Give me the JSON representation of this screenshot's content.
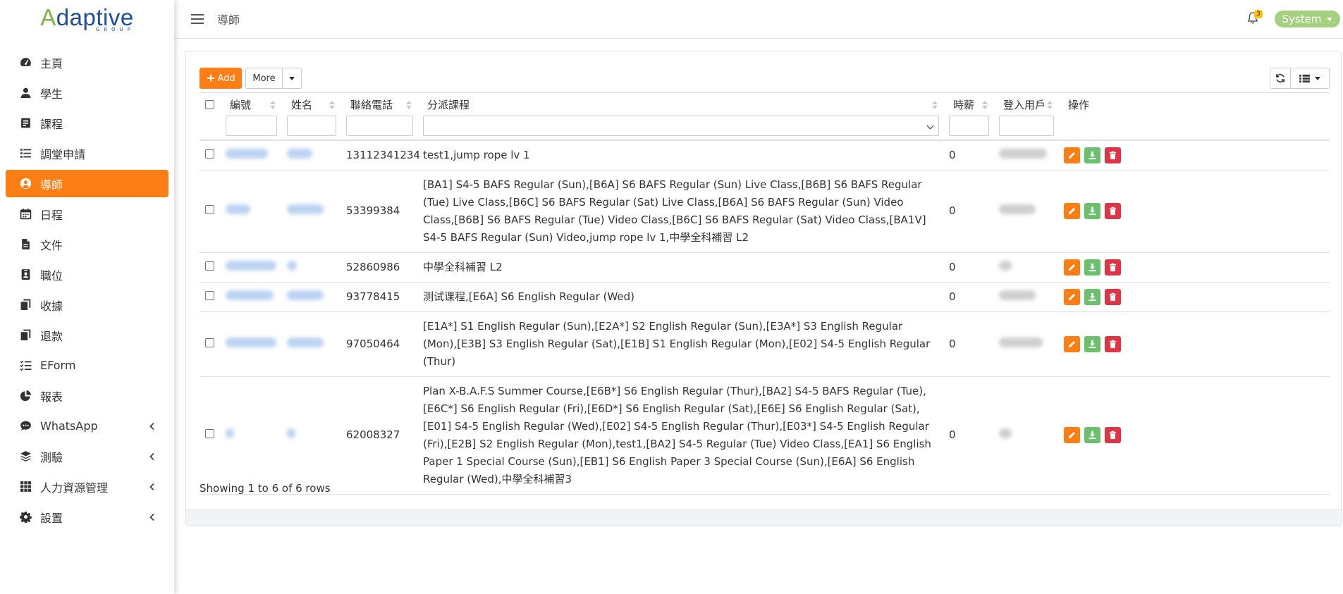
{
  "brand": {
    "logo_text_a": "A",
    "logo_text_rest": "daptive",
    "logo_sub": "GROUP"
  },
  "sidebar": {
    "items": [
      {
        "label": "主頁",
        "icon": "dashboard-icon",
        "active": false,
        "submenu": false
      },
      {
        "label": "學生",
        "icon": "user-icon",
        "active": false,
        "submenu": false
      },
      {
        "label": "課程",
        "icon": "course-icon",
        "active": false,
        "submenu": false
      },
      {
        "label": "調堂申請",
        "icon": "list-icon",
        "active": false,
        "submenu": false
      },
      {
        "label": "導師",
        "icon": "user-circle-icon",
        "active": true,
        "submenu": false
      },
      {
        "label": "日程",
        "icon": "calendar-icon",
        "active": false,
        "submenu": false
      },
      {
        "label": "文件",
        "icon": "file-icon",
        "active": false,
        "submenu": false
      },
      {
        "label": "職位",
        "icon": "id-badge-icon",
        "active": false,
        "submenu": false
      },
      {
        "label": "收據",
        "icon": "copy-icon",
        "active": false,
        "submenu": false
      },
      {
        "label": "退款",
        "icon": "copy-icon",
        "active": false,
        "submenu": false
      },
      {
        "label": "EForm",
        "icon": "checklist-icon",
        "active": false,
        "submenu": false
      },
      {
        "label": "報表",
        "icon": "pie-chart-icon",
        "active": false,
        "submenu": false
      },
      {
        "label": "WhatsApp",
        "icon": "chat-icon",
        "active": false,
        "submenu": true
      },
      {
        "label": "測驗",
        "icon": "layers-icon",
        "active": false,
        "submenu": true
      },
      {
        "label": "人力資源管理",
        "icon": "grid-icon",
        "active": false,
        "submenu": true
      },
      {
        "label": "設置",
        "icon": "gear-icon",
        "active": false,
        "submenu": true
      }
    ]
  },
  "header": {
    "title": "導師",
    "notification_count": "3",
    "user": "System"
  },
  "toolbar": {
    "add_label": "Add",
    "more_label": "More"
  },
  "table": {
    "columns": [
      "編號",
      "姓名",
      "聯絡電話",
      "分派課程",
      "時薪",
      "登入用戶",
      "操作"
    ],
    "rows": [
      {
        "phone": "13112341234",
        "courses": "test1,jump rope lv 1",
        "rate": "0"
      },
      {
        "phone": "53399384",
        "courses": "[BA1] S4-5 BAFS Regular (Sun),[B6A] S6 BAFS Regular (Sun) Live Class,[B6B] S6 BAFS Regular (Tue) Live Class,[B6C] S6 BAFS Regular (Sat) Live Class,[B6A] S6 BAFS Regular (Sun) Video Class,[B6B] S6 BAFS Regular (Tue) Video Class,[B6C] S6 BAFS Regular (Sat) Video Class,[BA1V] S4-5 BAFS Regular (Sun) Video,jump rope lv 1,中學全科補習 L2",
        "rate": "0"
      },
      {
        "phone": "52860986",
        "courses": "中學全科補習 L2",
        "rate": "0"
      },
      {
        "phone": "93778415",
        "courses": "测试课程,[E6A] S6 English Regular (Wed)",
        "rate": "0"
      },
      {
        "phone": "97050464",
        "courses": "[E1A*] S1 English Regular (Sun),[E2A*] S2 English Regular (Sun),[E3A*] S3 English Regular (Mon),[E3B] S3 English Regular (Sat),[E1B] S1 English Regular (Mon),[E02] S4-5 English Regular (Thur)",
        "rate": "0"
      },
      {
        "phone": "62008327",
        "courses": "Plan X-B.A.F.S Summer Course,[E6B*] S6 English Regular (Thur),[BA2] S4-5 BAFS Regular (Tue),[E6C*] S6 English Regular (Fri),[E6D*] S6 English Regular (Sat),[E6E] S6 English Regular (Sat),[E01] S4-5 English Regular (Wed),[E02] S4-5 English Regular (Thur),[E03*] S4-5 English Regular (Fri),[E2B] S2 English Regular (Mon),test1,[BA2] S4-5 Regular (Tue) Video Class,[EA1] S6 English Paper 1 Special Course (Sun),[EB1] S6 English Paper 3 Special Course (Sun),[E6A] S6 English Regular (Wed),中學全科補習3",
        "rate": "0"
      }
    ],
    "footer": "Showing 1 to 6 of 6 rows"
  },
  "colors": {
    "accent": "#fd7e14",
    "success": "#6cbf6c",
    "danger": "#dc3545",
    "user_pill": "#a5d07f",
    "brand_blue": "#1b4f9c",
    "brand_green": "#7cb342"
  }
}
